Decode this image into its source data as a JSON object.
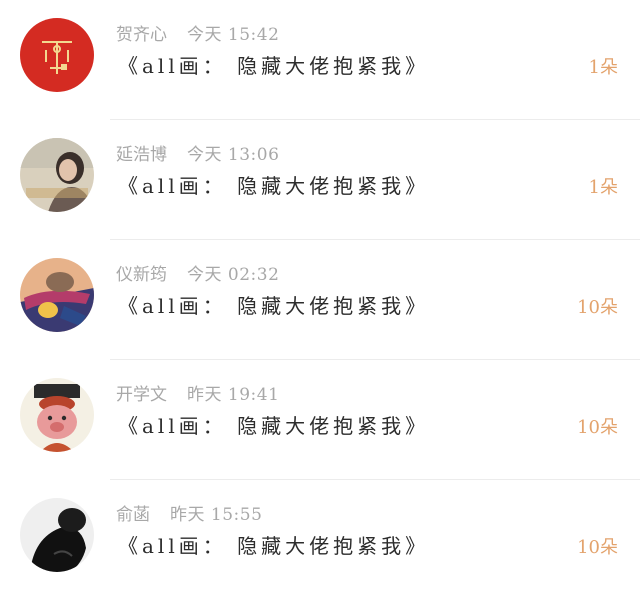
{
  "items": [
    {
      "name": "贺齐心",
      "time": "今天 15:42",
      "title": "《all画： 隐藏大佬抱紧我》",
      "count": "1朵",
      "avatar_icon": "red-seal-avatar-icon"
    },
    {
      "name": "延浩博",
      "time": "今天 13:06",
      "title": "《all画： 隐藏大佬抱紧我》",
      "count": "1朵",
      "avatar_icon": "girl-portrait-avatar-icon"
    },
    {
      "name": "仪新筠",
      "time": "今天 02:32",
      "title": "《all画： 隐藏大佬抱紧我》",
      "count": "10朵",
      "avatar_icon": "game-character-avatar-icon"
    },
    {
      "name": "开学文",
      "time": "昨天 19:41",
      "title": "《all画： 隐藏大佬抱紧我》",
      "count": "10朵",
      "avatar_icon": "cartoon-pig-avatar-icon"
    },
    {
      "name": "俞菡",
      "time": "昨天 15:55",
      "title": "《all画： 隐藏大佬抱紧我》",
      "count": "10朵",
      "avatar_icon": "dark-silhouette-avatar-icon"
    }
  ],
  "colors": {
    "meta_text": "#a8a8a8",
    "title_text": "#2d2d2d",
    "count_text": "#e3a36d",
    "separator": "#ececec"
  }
}
